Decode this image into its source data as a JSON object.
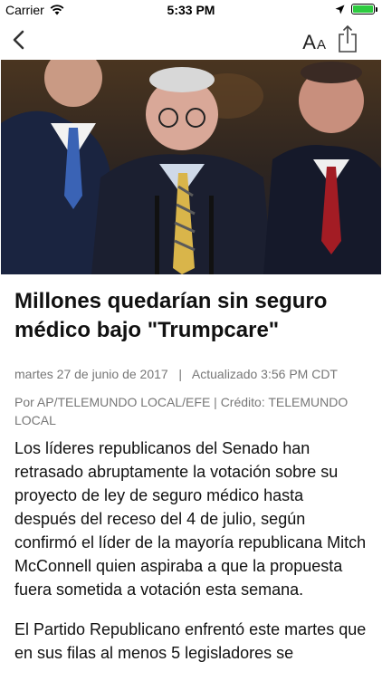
{
  "status_bar": {
    "carrier": "Carrier",
    "time": "5:33 PM"
  },
  "nav": {
    "text_size_big": "A",
    "text_size_small": "A"
  },
  "article": {
    "headline": "Millones quedarían sin seguro médico bajo \"Trumpcare\"",
    "date": "martes 27 de junio de 2017",
    "separator": "|",
    "updated": "Actualizado 3:56 PM CDT",
    "byline": "Por AP/TELEMUNDO LOCAL/EFE | Crédito: TELEMUNDO LOCAL",
    "paragraphs": [
      "Los líderes republicanos del Senado han retrasado abruptamente la votación sobre su proyecto de ley de seguro médico hasta después del receso del 4 de julio, según confirmó el líder de la mayoría republicana Mitch McConnell quien aspiraba a que la propuesta fuera sometida a votación esta semana.",
      "El Partido Republicano enfrentó este martes que en sus filas al menos 5 legisladores se"
    ]
  },
  "colors": {
    "accent": "#111111",
    "meta_text": "#777777",
    "battery": "#2ecc40"
  },
  "icons": [
    "wifi-icon",
    "location-arrow-icon",
    "battery-icon",
    "back-chevron-icon",
    "text-size-icon",
    "share-icon"
  ]
}
